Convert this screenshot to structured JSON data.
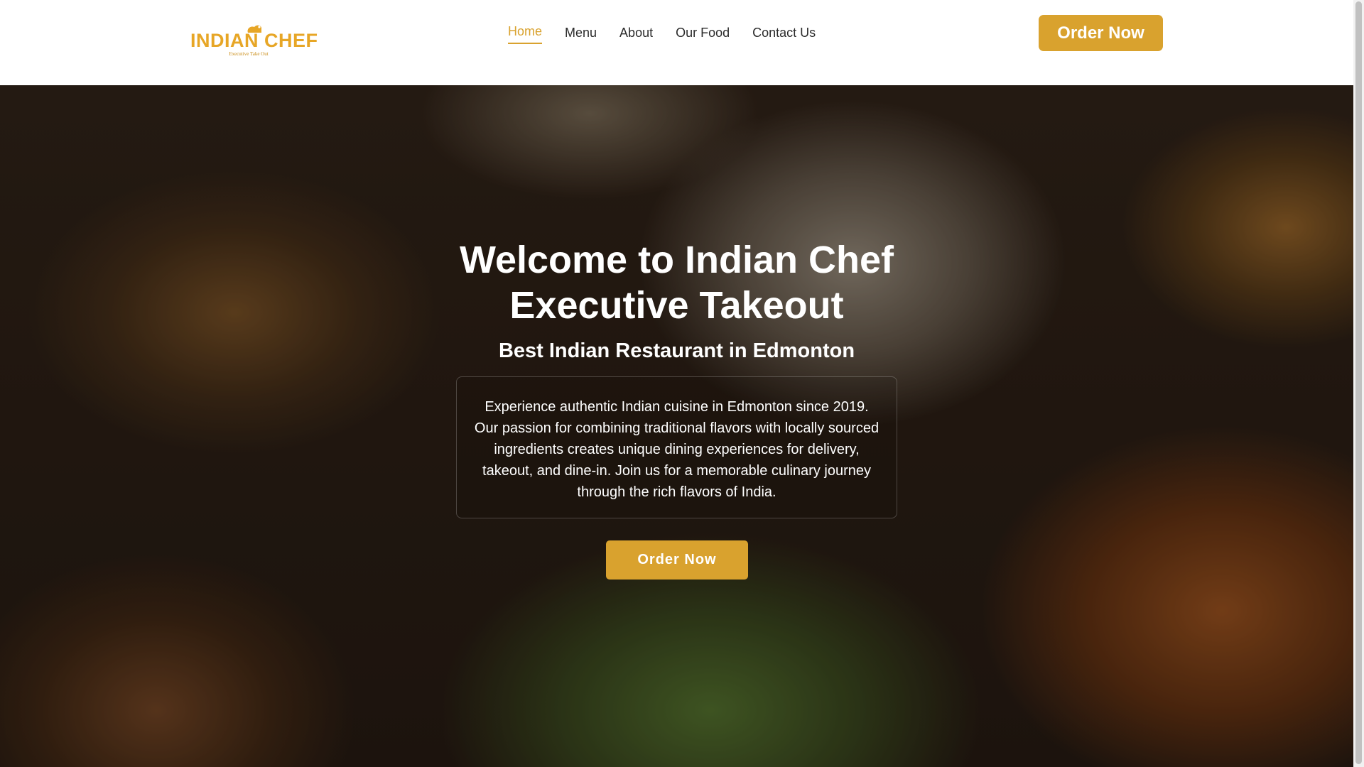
{
  "header": {
    "logo": {
      "text": "INDIAN CHEF",
      "tagline": "Executive Take Out"
    },
    "nav": [
      {
        "label": "Home",
        "active": true
      },
      {
        "label": "Menu",
        "active": false
      },
      {
        "label": "About",
        "active": false
      },
      {
        "label": "Our Food",
        "active": false
      },
      {
        "label": "Contact Us",
        "active": false
      }
    ],
    "order_button": "Order Now"
  },
  "hero": {
    "title_line1": "Welcome to Indian Chef",
    "title_line2": "Executive Takeout",
    "subtitle": "Best Indian Restaurant in Edmonton",
    "description": "Experience authentic Indian cuisine in Edmonton since 2019. Our passion for combining traditional flavors with locally sourced ingredients creates unique dining experiences for delivery, takeout, and dine-in. Join us for a memorable culinary journey through the rich flavors of India.",
    "order_button": "Order Now"
  },
  "theme": {
    "accent": "#d9a22e",
    "logo_color": "#e7a626",
    "nav_text": "#2b2b2b",
    "hero_text": "#ffffff"
  }
}
